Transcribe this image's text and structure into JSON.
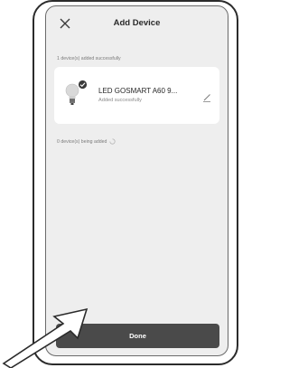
{
  "header": {
    "title": "Add Device",
    "close_icon": "close-icon"
  },
  "summary": {
    "added_text": "1 device(s) added successfully",
    "adding_text": "0 device(s) being added"
  },
  "device": {
    "name": "LED GOSMART A60 9...",
    "status": "Added successfully",
    "icon": "light-bulb-icon",
    "badge_icon": "check-badge-icon",
    "edit_icon": "pencil-icon"
  },
  "footer": {
    "done_label": "Done"
  },
  "colors": {
    "screen_bg": "#eeeeee",
    "card_bg": "#ffffff",
    "button_bg": "#4a4a4a",
    "badge": "#3a3a3a"
  }
}
